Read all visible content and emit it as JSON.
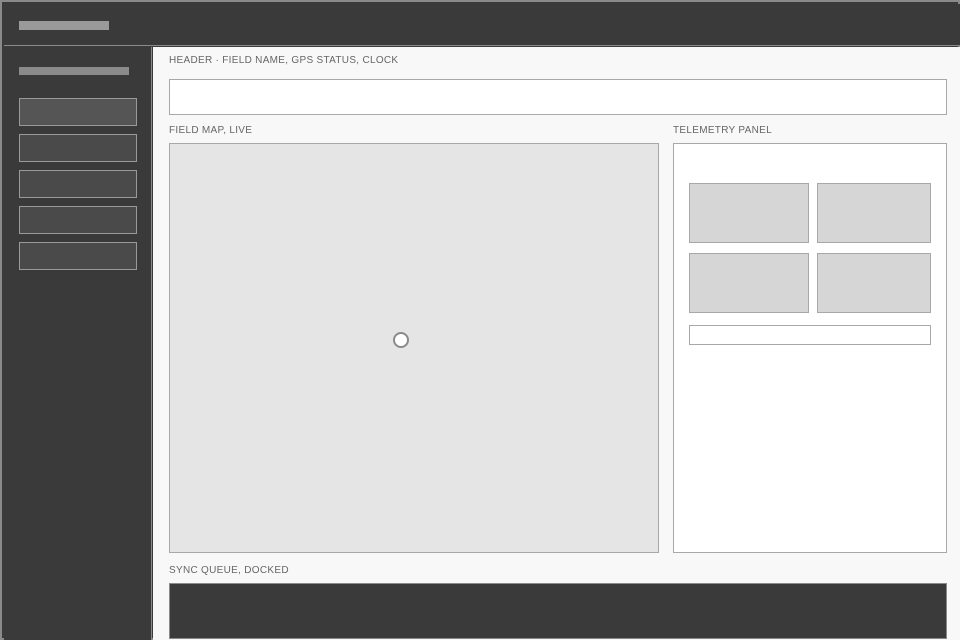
{
  "sections": {
    "header_label": "HEADER · FIELD NAME, GPS STATUS, CLOCK",
    "map_label": "FIELD MAP, LIVE",
    "telemetry_label": "TELEMETRY PANEL",
    "sync_label": "SYNC QUEUE, DOCKED"
  },
  "sidebar": {
    "nav_items": [
      {
        "label": ""
      },
      {
        "label": ""
      },
      {
        "label": ""
      },
      {
        "label": ""
      },
      {
        "label": ""
      }
    ]
  },
  "colors": {
    "chrome": "#3a3a3a",
    "content_bg": "#f8f8f8",
    "map_bg": "#e5e5e5",
    "tile_bg": "#d6d6d6",
    "border": "#a8a8a8"
  }
}
